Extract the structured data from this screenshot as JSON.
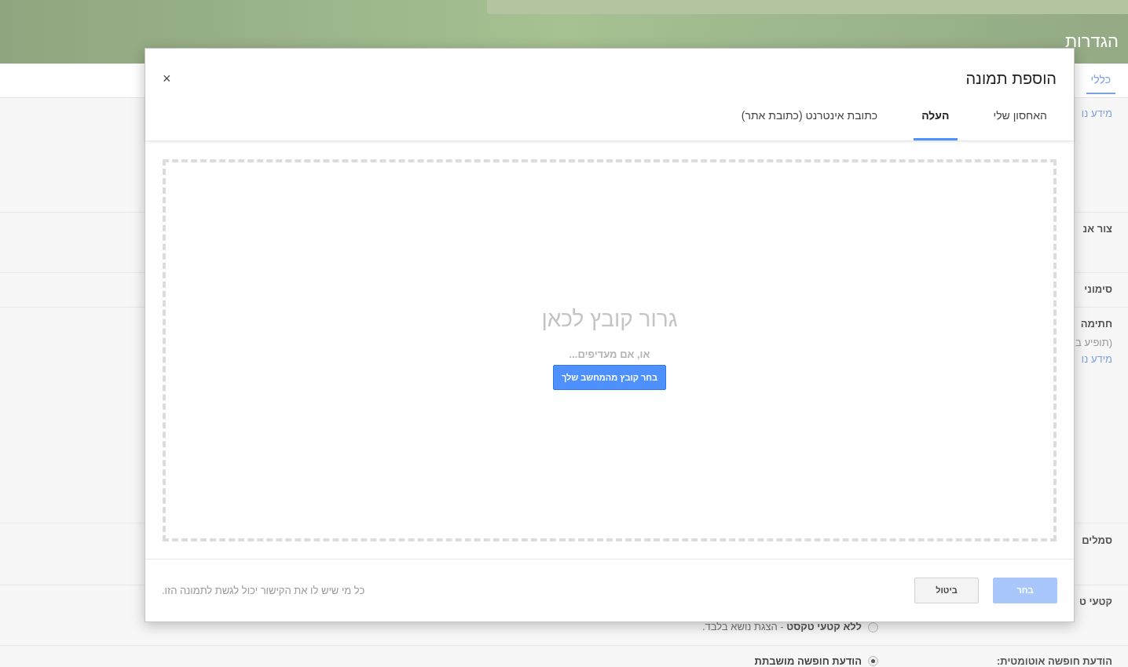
{
  "page": {
    "title": "הגדרות",
    "tabs": [
      {
        "label": "כללי",
        "selected": true
      }
    ],
    "rows": [
      {
        "label": "מידע נו",
        "kind": "link"
      },
      {
        "label": "צור אנ",
        "kind": "label"
      },
      {
        "label": "סימוני",
        "kind": "label"
      },
      {
        "label": "חתימה",
        "kind": "label"
      },
      {
        "label": "(תופיע ב",
        "kind": "note"
      },
      {
        "label": "מידע נו",
        "kind": "link"
      },
      {
        "label": "סמלים",
        "kind": "label"
      },
      {
        "label": "קטעי ט",
        "kind": "label"
      }
    ],
    "snippet_option": {
      "bold": "ללא קטעי טקסט",
      "rest": " - הצגת נושא בלבד.",
      "selected": false
    },
    "vacation": {
      "label": "הודעת חופשה אוטומטית:",
      "option": "הודעת חופשה מושבתת",
      "selected": true
    }
  },
  "dialog": {
    "title": "הוספת תמונה",
    "close": "×",
    "tabs": [
      {
        "label": "האחסון שלי",
        "selected": false
      },
      {
        "label": "העלה",
        "selected": true
      },
      {
        "label": "כתובת אינטרנט (כתובת אתר)",
        "selected": false
      }
    ],
    "drop": {
      "heading": "גרור קובץ לכאן",
      "or": "או, אם מעדיפים...",
      "button": "בחר קובץ מהמחשב שלך"
    },
    "footer": {
      "select": {
        "label": "בחר",
        "disabled": true
      },
      "cancel": "ביטול",
      "note": "כל מי שיש לו את הקישור יכול לגשת לתמונה הזו."
    }
  }
}
